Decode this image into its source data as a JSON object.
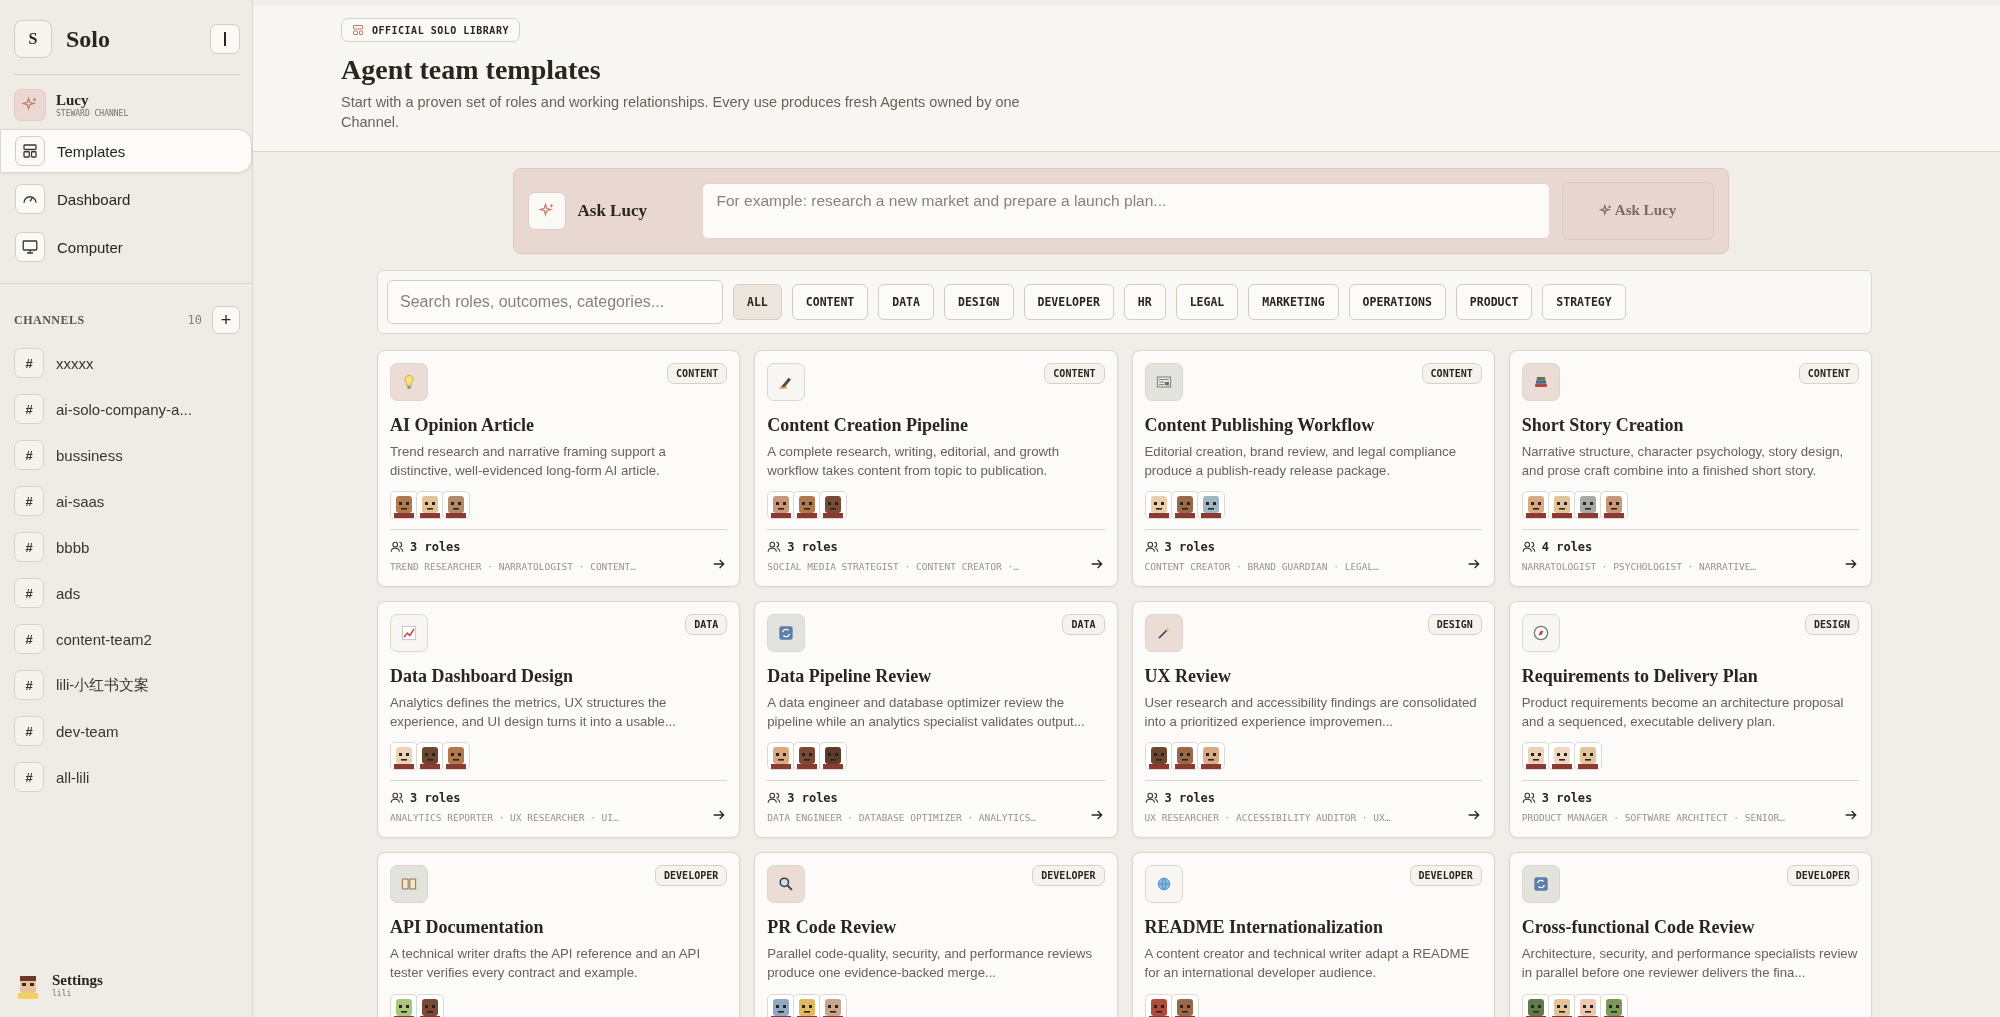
{
  "sidebar": {
    "logo_letter": "S",
    "app_name": "Solo",
    "steward": {
      "name": "Lucy",
      "subtitle": "STEWARD CHANNEL"
    },
    "nav": [
      {
        "label": "Templates",
        "selected": true
      },
      {
        "label": "Dashboard",
        "selected": false
      },
      {
        "label": "Computer",
        "selected": false
      }
    ],
    "channels_heading": "CHANNELS",
    "channels_count": "10",
    "add_label": "+",
    "channels": [
      {
        "icon": "#",
        "name": "xxxxx"
      },
      {
        "icon": "#",
        "name": "ai-solo-company-a..."
      },
      {
        "icon": "#",
        "name": "bussiness"
      },
      {
        "icon": "#",
        "name": "ai-saas"
      },
      {
        "icon": "#",
        "name": "bbbb"
      },
      {
        "icon": "#",
        "name": "ads"
      },
      {
        "icon": "#",
        "name": "content-team2"
      },
      {
        "icon": "#",
        "name": "lili-小红书文案"
      },
      {
        "icon": "#",
        "name": "dev-team"
      },
      {
        "icon": "#",
        "name": "all-lili"
      }
    ],
    "settings": {
      "label": "Settings",
      "user": "lili"
    }
  },
  "header": {
    "badge": "OFFICIAL SOLO LIBRARY",
    "title": "Agent team templates",
    "subtitle": "Start with a proven set of roles and working relationships. Every use produces fresh Agents owned by one Channel."
  },
  "ask": {
    "label": "Ask Lucy",
    "placeholder": "For example: research a new market and prepare a launch plan...",
    "button": "Ask Lucy"
  },
  "search": {
    "placeholder": "Search roles, outcomes, categories..."
  },
  "filters": [
    {
      "label": "ALL",
      "selected": true
    },
    {
      "label": "CONTENT",
      "selected": false
    },
    {
      "label": "DATA",
      "selected": false
    },
    {
      "label": "DESIGN",
      "selected": false
    },
    {
      "label": "DEVELOPER",
      "selected": false
    },
    {
      "label": "HR",
      "selected": false
    },
    {
      "label": "LEGAL",
      "selected": false
    },
    {
      "label": "MARKETING",
      "selected": false
    },
    {
      "label": "OPERATIONS",
      "selected": false
    },
    {
      "label": "PRODUCT",
      "selected": false
    },
    {
      "label": "STRATEGY",
      "selected": false
    }
  ],
  "cards": [
    {
      "color": "#ecdcd6",
      "category": "CONTENT",
      "title": "AI Opinion Article",
      "description": "Trend research and narrative framing support a distinctive, well-evidenced long-form AI article.",
      "avatars": [
        {
          "color": "#b07a4e"
        },
        {
          "color": "#e2c39a"
        },
        {
          "color": "#b58a68"
        }
      ],
      "roles_count": "3 roles",
      "roles": "TREND RESEARCHER · NARRATOLOGIST · CONTENT…"
    },
    {
      "color": "#f8f6f2",
      "category": "CONTENT",
      "title": "Content Creation Pipeline",
      "description": "A complete research, writing, editorial, and growth workflow takes content from topic to publication.",
      "avatars": [
        {
          "color": "#c9967a"
        },
        {
          "color": "#b07a4e"
        },
        {
          "color": "#7a4a36"
        }
      ],
      "roles_count": "3 roles",
      "roles": "SOCIAL MEDIA STRATEGIST · CONTENT CREATOR ·…"
    },
    {
      "color": "#e2e3dc",
      "category": "CONTENT",
      "title": "Content Publishing Workflow",
      "description": "Editorial creation, brand review, and legal compliance produce a publish-ready release package.",
      "avatars": [
        {
          "color": "#e8cfb0"
        },
        {
          "color": "#9a6a48"
        },
        {
          "color": "#9cb8c4"
        }
      ],
      "roles_count": "3 roles",
      "roles": "CONTENT CREATOR · BRAND GUARDIAN · LEGAL…"
    },
    {
      "color": "#ecdcd6",
      "category": "CONTENT",
      "title": "Short Story Creation",
      "description": "Narrative structure, character psychology, story design, and prose craft combine into a finished short story.",
      "avatars": [
        {
          "color": "#d9a982"
        },
        {
          "color": "#e2c39a"
        },
        {
          "color": "#a7a9a6"
        },
        {
          "color": "#c9967a"
        }
      ],
      "roles_count": "4 roles",
      "roles": "NARRATOLOGIST · PSYCHOLOGIST · NARRATIVE…"
    },
    {
      "color": "#f8f6f2",
      "category": "DATA",
      "title": "Data Dashboard Design",
      "description": "Analytics defines the metrics, UX structures the experience, and UI design turns it into a usable...",
      "avatars": [
        {
          "color": "#ecd3b8"
        },
        {
          "color": "#6e4630"
        },
        {
          "color": "#b07a4e"
        }
      ],
      "roles_count": "3 roles",
      "roles": "ANALYTICS REPORTER · UX RESEARCHER · UI…"
    },
    {
      "color": "#e2e3dc",
      "category": "DATA",
      "title": "Data Pipeline Review",
      "description": "A data engineer and database optimizer review the pipeline while an analytics specialist validates output...",
      "avatars": [
        {
          "color": "#d9a982"
        },
        {
          "color": "#7a4a36"
        },
        {
          "color": "#5e3a28"
        }
      ],
      "roles_count": "3 roles",
      "roles": "DATA ENGINEER · DATABASE OPTIMIZER · ANALYTICS…"
    },
    {
      "color": "#ecdcd6",
      "category": "DESIGN",
      "title": "UX Review",
      "description": "User research and accessibility findings are consolidated into a prioritized experience improvemen...",
      "avatars": [
        {
          "color": "#6e4630"
        },
        {
          "color": "#9a6a48"
        },
        {
          "color": "#d9a982"
        }
      ],
      "roles_count": "3 roles",
      "roles": "UX RESEARCHER · ACCESSIBILITY AUDITOR · UX…"
    },
    {
      "color": "#f8f6f2",
      "category": "DESIGN",
      "title": "Requirements to Delivery Plan",
      "description": "Product requirements become an architecture proposal and a sequenced, executable delivery plan.",
      "avatars": [
        {
          "color": "#ecd3b8"
        },
        {
          "color": "#f0d8c4"
        },
        {
          "color": "#e2c39a"
        }
      ],
      "roles_count": "3 roles",
      "roles": "PRODUCT MANAGER · SOFTWARE ARCHITECT · SENIOR…"
    },
    {
      "color": "#e2e3dc",
      "category": "DEVELOPER",
      "title": "API Documentation",
      "description": "A technical writer drafts the API reference and an API tester verifies every contract and example.",
      "avatars": [
        {
          "color": "#a9c77a"
        },
        {
          "color": "#7a4a36"
        }
      ]
    },
    {
      "color": "#ecdcd6",
      "category": "DEVELOPER",
      "title": "PR Code Review",
      "description": "Parallel code-quality, security, and performance reviews produce one evidence-backed merge...",
      "avatars": [
        {
          "color": "#8fa8c4"
        },
        {
          "color": "#e2b860"
        },
        {
          "color": "#c9a68a"
        }
      ]
    },
    {
      "color": "#f8f6f2",
      "category": "DEVELOPER",
      "title": "README Internationalization",
      "description": "A content creator and technical writer adapt a README for an international developer audience.",
      "avatars": [
        {
          "color": "#b04a3a"
        },
        {
          "color": "#9a6a48"
        }
      ]
    },
    {
      "color": "#e2e3dc",
      "category": "DEVELOPER",
      "title": "Cross-functional Code Review",
      "description": "Architecture, security, and performance specialists review in parallel before one reviewer delivers the fina...",
      "avatars": [
        {
          "color": "#5e7a4a"
        },
        {
          "color": "#e2c39a"
        },
        {
          "color": "#ecc8b0"
        },
        {
          "color": "#7a9a5a"
        }
      ]
    }
  ]
}
